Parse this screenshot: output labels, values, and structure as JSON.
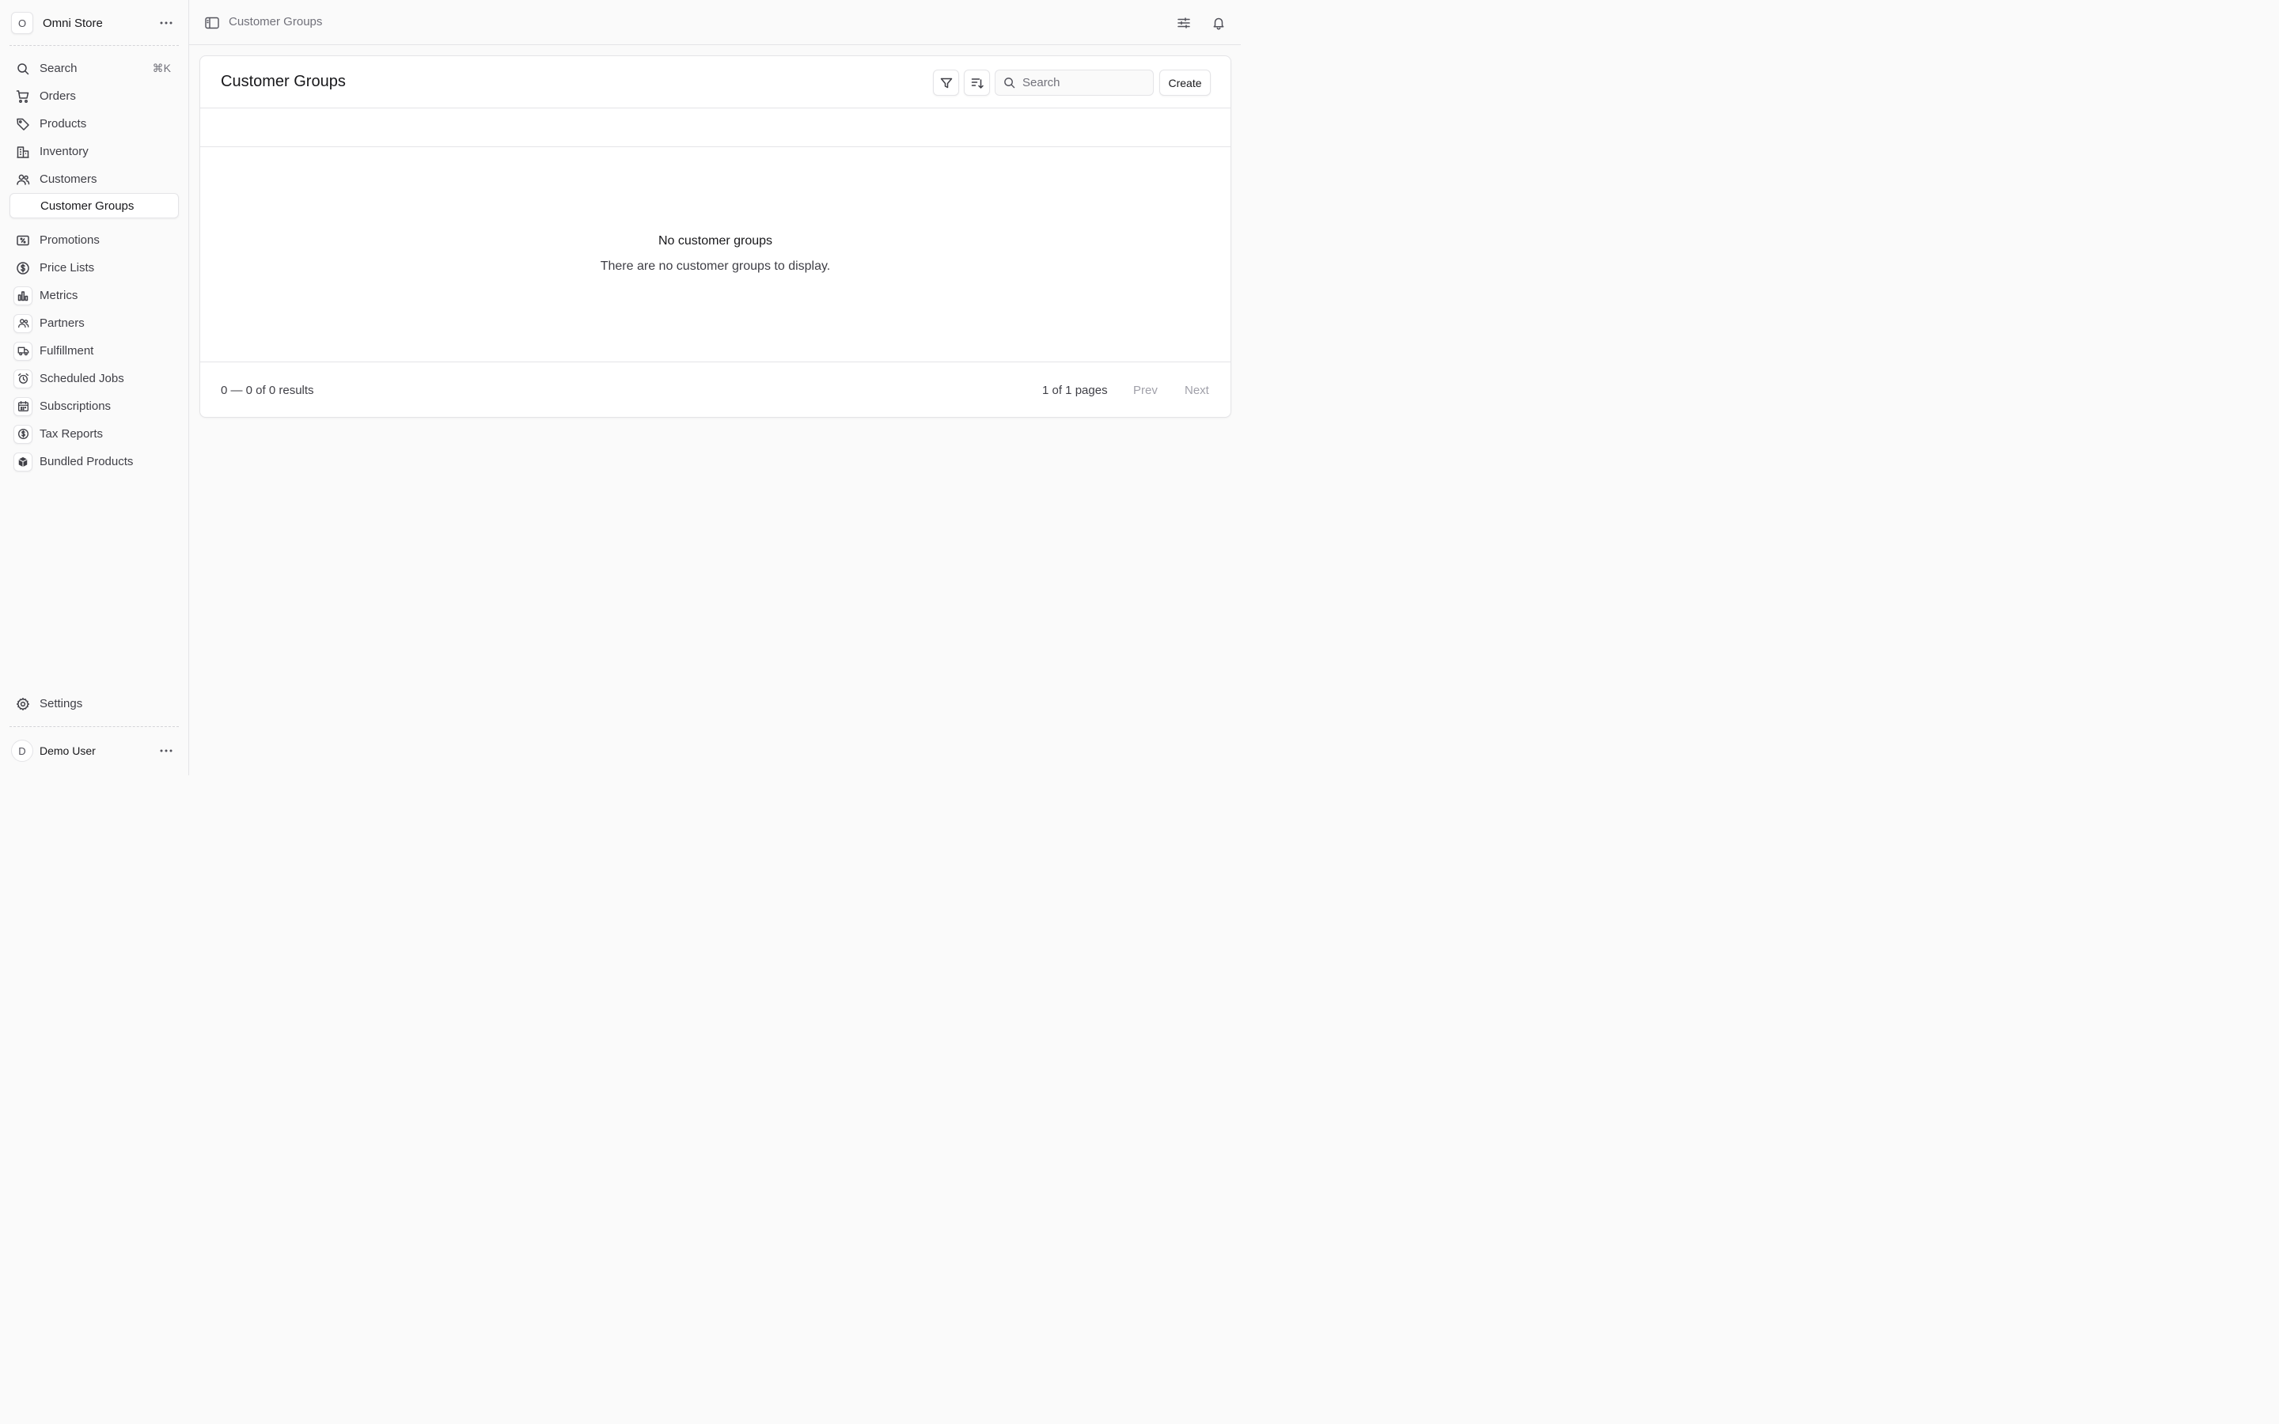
{
  "store": {
    "avatar_letter": "O",
    "name": "Omni Store"
  },
  "nav": {
    "search": {
      "label": "Search",
      "shortcut": "⌘K"
    },
    "items": [
      {
        "label": "Orders",
        "icon": "cart-icon"
      },
      {
        "label": "Products",
        "icon": "tag-icon"
      },
      {
        "label": "Inventory",
        "icon": "building-icon"
      },
      {
        "label": "Customers",
        "icon": "users-icon"
      }
    ],
    "sub_active": {
      "label": "Customer Groups"
    },
    "extensions": [
      {
        "label": "Promotions",
        "icon": "receipt-percent-icon"
      },
      {
        "label": "Price Lists",
        "icon": "currency-dollar-icon"
      },
      {
        "label": "Metrics",
        "icon": "bar-chart-icon"
      },
      {
        "label": "Partners",
        "icon": "users-icon"
      },
      {
        "label": "Fulfillment",
        "icon": "truck-icon"
      },
      {
        "label": "Scheduled Jobs",
        "icon": "alarm-clock-icon"
      },
      {
        "label": "Subscriptions",
        "icon": "calendar-icon"
      },
      {
        "label": "Tax Reports",
        "icon": "currency-dollar-icon"
      },
      {
        "label": "Bundled Products",
        "icon": "cube-icon"
      }
    ],
    "settings": {
      "label": "Settings"
    }
  },
  "user": {
    "avatar_letter": "D",
    "name": "Demo User"
  },
  "topbar": {
    "breadcrumb": "Customer Groups"
  },
  "page": {
    "title": "Customer Groups",
    "search_placeholder": "Search",
    "create_label": "Create",
    "empty_title": "No customer groups",
    "empty_description": "There are no customer groups to display.",
    "results_text": "0 — 0 of 0 results",
    "pages_text": "1 of 1 pages",
    "prev_label": "Prev",
    "next_label": "Next"
  }
}
